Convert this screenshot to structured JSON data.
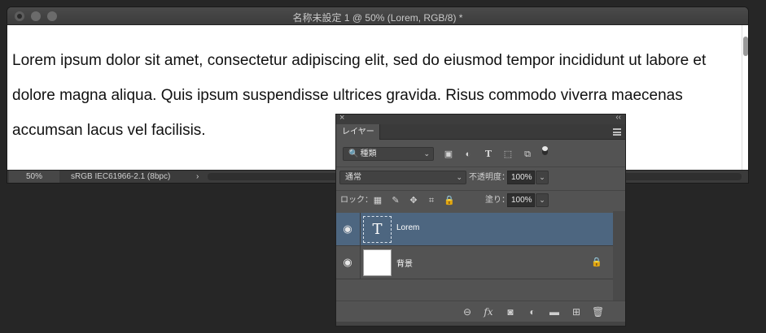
{
  "document": {
    "title": "名称未設定 1 @ 50% (Lorem, RGB/8) *",
    "canvas_text": "Lorem ipsum dolor sit amet, consectetur adipiscing elit, sed do eiusmod tempor incididunt ut labore et dolore magna aliqua. Quis ipsum suspendisse ultrices gravida. Risus commodo viverra maecenas accumsan lacus vel facilisis.",
    "status": {
      "zoom": "50%",
      "profile": "sRGB IEC61966-2.1 (8bpc)",
      "arrow": "›"
    }
  },
  "layers_panel": {
    "close_glyph": "×",
    "collapse_glyph": "‹‹",
    "tab_label": "レイヤー",
    "filter": {
      "search_glyph": "🔍",
      "label": "種類",
      "chevron": "⌄"
    },
    "blend_mode": {
      "label": "通常",
      "chevron": "⌄"
    },
    "opacity": {
      "label": "不透明度：",
      "value": "100%"
    },
    "lock": {
      "label": "ロック："
    },
    "fill": {
      "label": "塗り：",
      "value": "100%"
    },
    "layers": [
      {
        "name": "Lorem",
        "thumb_glyph": "T",
        "selected": true,
        "locked": false
      },
      {
        "name": "背景",
        "selected": false,
        "locked": true
      }
    ],
    "icons": {
      "eye": "◉",
      "lock": "🔒",
      "image_filter": "▣",
      "adjust_filter": "◐",
      "type_filter": "T",
      "shape_filter": "⬚",
      "smart_filter": "⧉",
      "lock_pixels": "▦",
      "lock_paint": "✎",
      "lock_move": "✥",
      "lock_artboard": "⌗",
      "lock_all": "🔒",
      "link": "⊖",
      "fx": "fx",
      "mask": "◙",
      "adjustment": "◐",
      "folder": "▬",
      "new_layer": "⊞",
      "trash": "🗑"
    }
  }
}
